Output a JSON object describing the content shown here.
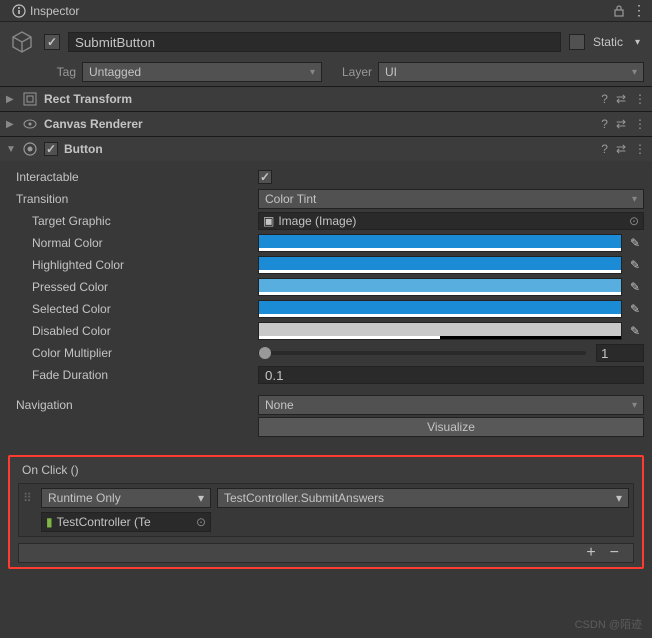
{
  "tab": {
    "title": "Inspector"
  },
  "header": {
    "name": "SubmitButton",
    "enabled": true,
    "static_label": "Static",
    "static_checked": false,
    "tag_label": "Tag",
    "tag_value": "Untagged",
    "layer_label": "Layer",
    "layer_value": "UI"
  },
  "components": {
    "rect_transform": {
      "title": "Rect Transform",
      "expanded": false
    },
    "canvas_renderer": {
      "title": "Canvas Renderer",
      "expanded": false
    },
    "button": {
      "title": "Button",
      "enabled": true,
      "expanded": true,
      "props": {
        "interactable_label": "Interactable",
        "interactable": true,
        "transition_label": "Transition",
        "transition_value": "Color Tint",
        "target_graphic_label": "Target Graphic",
        "target_graphic_value": "Image (Image)",
        "normal_color_label": "Normal Color",
        "normal_color": "#1b8bd6",
        "normal_alpha": 1.0,
        "highlighted_color_label": "Highlighted Color",
        "highlighted_color": "#1b8bd6",
        "highlighted_alpha": 1.0,
        "pressed_color_label": "Pressed Color",
        "pressed_color": "#59aee0",
        "pressed_alpha": 1.0,
        "selected_color_label": "Selected Color",
        "selected_color": "#1b8bd6",
        "selected_alpha": 1.0,
        "disabled_color_label": "Disabled Color",
        "disabled_color": "#c8c8c8",
        "disabled_alpha": 0.5,
        "color_multiplier_label": "Color Multiplier",
        "color_multiplier": 1,
        "fade_duration_label": "Fade Duration",
        "fade_duration": "0.1",
        "navigation_label": "Navigation",
        "navigation_value": "None",
        "visualize_label": "Visualize"
      },
      "onclick": {
        "title": "On Click ()",
        "runtime": "Runtime Only",
        "function": "TestController.SubmitAnswers",
        "target": "TestController (Te"
      }
    }
  },
  "watermark": "CSDN @陌迹"
}
